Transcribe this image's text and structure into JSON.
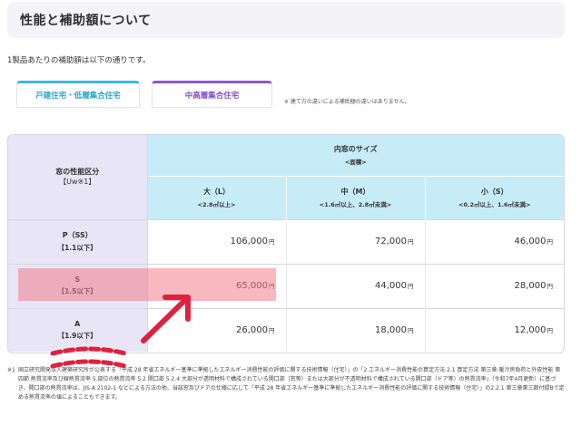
{
  "header": {
    "title": "性能と補助額について"
  },
  "intro": "1製品あたりの補助額は以下の通りです。",
  "tabs": [
    {
      "label": "戸建住宅・低層集合住宅"
    },
    {
      "label": "中高層集合住宅"
    }
  ],
  "tab_note": "※ 建て方の違いによる補助額の違いはありません。",
  "table": {
    "perf_header": "窓の性能区分",
    "perf_header_sub": "【Uw※1】",
    "size_header": "内窓のサイズ",
    "size_header_sub": "<面積>",
    "columns": [
      {
        "label": "大（L）",
        "sub": "<2.8㎡以上>"
      },
      {
        "label": "中（M）",
        "sub": "<1.6㎡以上、2.8㎡未満>"
      },
      {
        "label": "小（S）",
        "sub": "<0.2㎡以上、1.6㎡未満>"
      }
    ],
    "rows": [
      {
        "grade": "P（SS）",
        "range": "【1.1以下】",
        "values": [
          "106,000",
          "72,000",
          "46,000"
        ]
      },
      {
        "grade": "S",
        "range": "【1.5以下】",
        "values": [
          "65,000",
          "44,000",
          "28,000"
        ]
      },
      {
        "grade": "A",
        "range": "【1.9以下】",
        "values": [
          "26,000",
          "18,000",
          "12,000"
        ]
      }
    ],
    "currency": "円"
  },
  "footnote": {
    "mark": "※1",
    "text": "国立研究開発法人建築研究所が公表する「平成 28 年省エネルギー基準に準拠したエネルギー消費性能の評価に関する技術情報（住宅）」の「2.エネルギー消費性能の算定方法 2.1 算定方法 第三章 暖冷房負荷と外皮性能 第四節 熱貫流率及び線熱貫流率 5.部位の熱貫流率 5.2 開口部 5.2.4 大部分が透明材料で構成されている開口部（窓等）または大部分が不透明材料で構成されている開口部（ドア等）の熱貫流率」（令和7年4月更新）に基づき、開口部の熱貫流率は、JIS A 2102-1 などによる方法の他、当該窓及びドアの仕様に応じて「平成 28 年省エネルギー基準に準拠したエネルギー消費性能の評価に関する技術情報（住宅）」の2.2.1 第三章第三節付録Bで定める熱貫流率の値によることもできます。"
  },
  "colors": {
    "highlight": "#f07d8c",
    "arrow": "#e0213d",
    "tab1_accent": "#3cb7e6",
    "tab2_accent": "#8c55d6",
    "perf_bg": "#e8e5f6",
    "size_bg": "#c6ecf7"
  }
}
